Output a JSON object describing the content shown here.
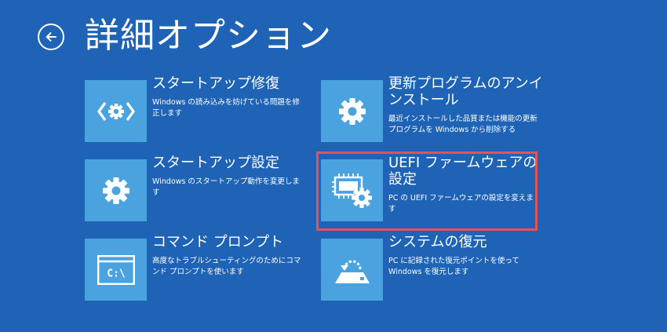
{
  "header": {
    "title": "詳細オプション",
    "back_icon": "back-arrow-circle-icon"
  },
  "colors": {
    "background": "#1f63b7",
    "tile": "#4aa3df",
    "highlight": "#e35454"
  },
  "options": [
    {
      "title": "スタートアップ修復",
      "description": "Windows の読み込みを妨げている問題を修正します",
      "icon": "startup-repair-icon"
    },
    {
      "title": "スタートアップ設定",
      "description": "Windows のスタートアップ動作を変更します",
      "icon": "gear-icon"
    },
    {
      "title": "コマンド プロンプト",
      "description": "高度なトラブルシューティングのためにコマンド プロンプトを使います",
      "icon": "command-prompt-icon",
      "icon_text": "C:\\"
    },
    {
      "title": "更新プログラムのアンインストール",
      "description": "最近インストールした品質または機能の更新プログラムを Windows から削除する",
      "icon": "gear-icon"
    },
    {
      "title": "UEFI ファームウェアの設定",
      "description": "PC の UEFI ファームウェアの設定を変えます",
      "icon": "firmware-chip-gear-icon",
      "highlighted": true
    },
    {
      "title": "システムの復元",
      "description": "PC に記録された復元ポイントを使って Windows を復元します",
      "icon": "system-restore-icon"
    }
  ]
}
